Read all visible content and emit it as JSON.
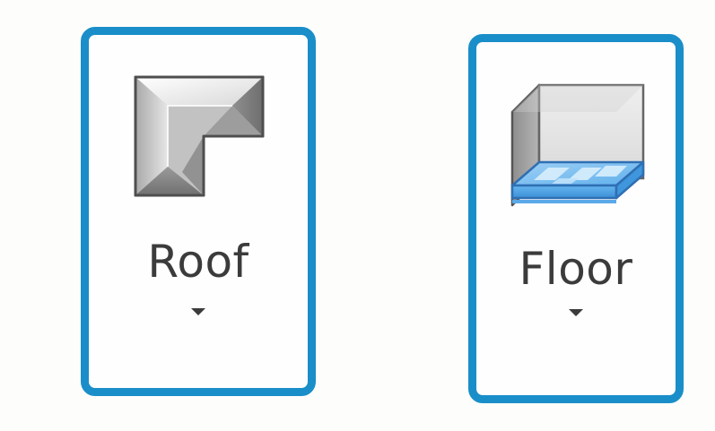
{
  "ribbon": {
    "buttons": [
      {
        "id": "roof",
        "label": "Roof",
        "icon": "roof-icon",
        "has_dropdown": true
      },
      {
        "id": "floor",
        "label": "Floor",
        "icon": "floor-icon",
        "has_dropdown": true
      }
    ],
    "highlight_color": "#1a8ec9",
    "label_color": "#3b3b3b"
  }
}
